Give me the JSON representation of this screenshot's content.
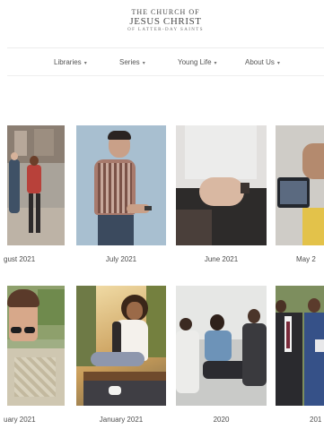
{
  "header": {
    "logo_line1": "THE CHURCH OF",
    "logo_line2": "JESUS CHRIST",
    "logo_line3": "OF LATTER-DAY SAINTS"
  },
  "nav": {
    "items": [
      {
        "label": "Libraries"
      },
      {
        "label": "Series"
      },
      {
        "label": "Young Life"
      },
      {
        "label": "About Us"
      }
    ]
  },
  "gallery": {
    "row1": [
      {
        "caption": "gust 2021"
      },
      {
        "caption": "July 2021"
      },
      {
        "caption": "June 2021"
      },
      {
        "caption": "May 2"
      }
    ],
    "row2": [
      {
        "caption": "uary 2021"
      },
      {
        "caption": "January 2021"
      },
      {
        "caption": "2020"
      },
      {
        "caption": "201"
      }
    ]
  }
}
